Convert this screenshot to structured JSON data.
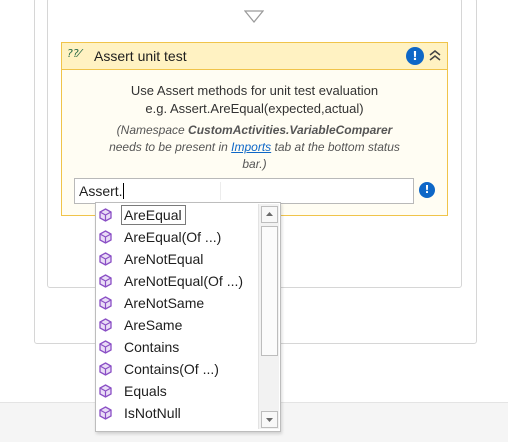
{
  "activity": {
    "title": "Assert unit test",
    "type_icon": "?",
    "description_line1": "Use Assert methods for unit test evaluation",
    "description_line2": "e.g. Assert.AreEqual(expected,actual)",
    "note_prefix": "(Namespace ",
    "note_namespace": "CustomActivities.VariableComparer",
    "note_line2_prefix": "needs to be present in ",
    "note_link": "Imports",
    "note_line2_suffix": " tab at the bottom status",
    "note_line3": "bar.)",
    "warning_icon": "!"
  },
  "expression": {
    "value": "Assert."
  },
  "autocomplete": {
    "selected_index": 0,
    "items": [
      "AreEqual",
      "AreEqual(Of ...)",
      "AreNotEqual",
      "AreNotEqual(Of ...)",
      "AreNotSame",
      "AreSame",
      "Contains",
      "Contains(Of ...)",
      "Equals",
      "IsNotNull"
    ]
  },
  "colors": {
    "header_bg": "#fff2c2",
    "border": "#f0c44a",
    "warning": "#0e67c7",
    "method_icon": "#8a4fc5"
  }
}
